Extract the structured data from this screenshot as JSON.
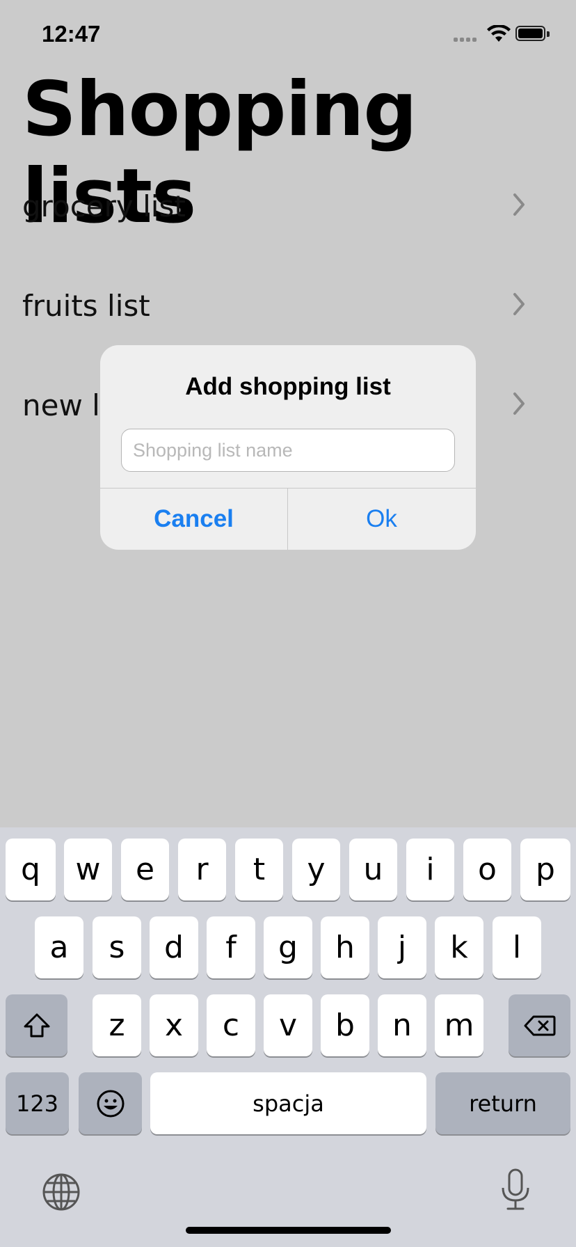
{
  "status_bar": {
    "time": "12:47"
  },
  "page": {
    "title": "Shopping lists"
  },
  "lists": [
    {
      "label": "grocery list"
    },
    {
      "label": "fruits list"
    },
    {
      "label": "new list"
    }
  ],
  "alert": {
    "title": "Add shopping list",
    "input_placeholder": "Shopping list name",
    "input_value": "",
    "cancel_label": "Cancel",
    "ok_label": "Ok",
    "accent_color": "#1a7ff0"
  },
  "keyboard": {
    "row1": [
      "q",
      "w",
      "e",
      "r",
      "t",
      "y",
      "u",
      "i",
      "o",
      "p"
    ],
    "row2": [
      "a",
      "s",
      "d",
      "f",
      "g",
      "h",
      "j",
      "k",
      "l"
    ],
    "row3": [
      "z",
      "x",
      "c",
      "v",
      "b",
      "n",
      "m"
    ],
    "numbers_label": "123",
    "space_label": "spacja",
    "return_label": "return",
    "icons": [
      "shift-icon",
      "backspace-icon",
      "emoji-icon",
      "globe-icon",
      "microphone-icon"
    ]
  }
}
